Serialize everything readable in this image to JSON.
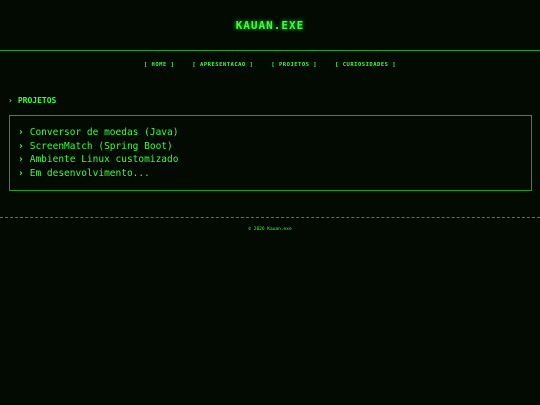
{
  "header": {
    "title": "KAUAN.EXE"
  },
  "nav": {
    "items": [
      {
        "label": "[ HOME ]"
      },
      {
        "label": "[ APRESENTACAO ]"
      },
      {
        "label": "[ PROJETOS ]"
      },
      {
        "label": "[ CURIOSIDADES ]"
      }
    ]
  },
  "section": {
    "chevron": "›",
    "title": "PROJETOS"
  },
  "projects": {
    "items": [
      {
        "label": "Conversor de moedas (Java)"
      },
      {
        "label": "ScreenMatch (Spring Boot)"
      },
      {
        "label": "Ambiente Linux customizado"
      },
      {
        "label": "Em desenvolvimento..."
      }
    ]
  },
  "footer": {
    "copyright": "© 2026 Kauan.exe"
  },
  "colors": {
    "text": "#39ff3a",
    "border": "#1f9c22",
    "background": "#020a02"
  }
}
